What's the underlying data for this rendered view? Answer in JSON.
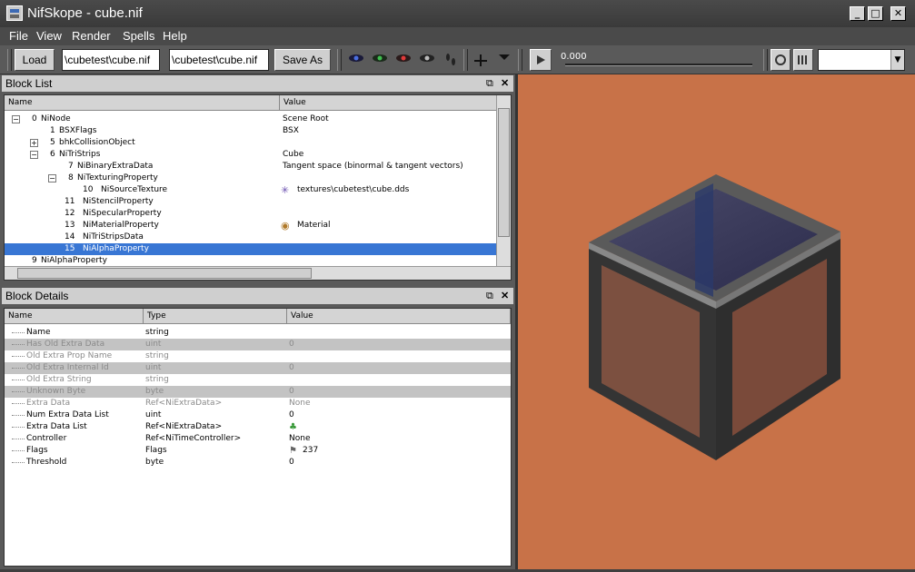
{
  "window": {
    "title": "NifSkope - cube.nif",
    "buttons": [
      "_",
      "□",
      "✕"
    ]
  },
  "menu": [
    "File",
    "View",
    "Render",
    "Spells",
    "Help"
  ],
  "toolbar": {
    "load_label": "Load",
    "path1": "\\cubetest\\cube.nif",
    "path2": "\\cubetest\\cube.nif",
    "save_label": "Save As",
    "time_value": "0.000",
    "combo_value": ""
  },
  "block_list": {
    "title": "Block List",
    "columns": [
      "Name",
      "Value"
    ],
    "rows": [
      {
        "num": "0",
        "name": "NiNode",
        "value": "Scene Root"
      },
      {
        "num": "1",
        "name": "BSXFlags",
        "value": "BSX"
      },
      {
        "num": "5",
        "name": "bhkCollisionObject",
        "value": ""
      },
      {
        "num": "6",
        "name": "NiTriStrips",
        "value": "Cube"
      },
      {
        "num": "7",
        "name": "NiBinaryExtraData",
        "value": "Tangent space (binormal & tangent vectors)"
      },
      {
        "num": "8",
        "name": "NiTexturingProperty",
        "value": ""
      },
      {
        "num": "10",
        "name": "NiSourceTexture",
        "value": "textures\\cubetest\\cube.dds"
      },
      {
        "num": "11",
        "name": "NiStencilProperty",
        "value": ""
      },
      {
        "num": "12",
        "name": "NiSpecularProperty",
        "value": ""
      },
      {
        "num": "13",
        "name": "NiMaterialProperty",
        "value": "Material"
      },
      {
        "num": "14",
        "name": "NiTriStripsData",
        "value": ""
      },
      {
        "num": "15",
        "name": "NiAlphaProperty",
        "value": ""
      },
      {
        "num": "9",
        "name": "NiAlphaProperty",
        "value": ""
      }
    ]
  },
  "block_details": {
    "title": "Block Details",
    "columns": [
      "Name",
      "Type",
      "Value"
    ],
    "rows": [
      {
        "name": "Name",
        "type": "string",
        "value": ""
      },
      {
        "name": "Has Old Extra Data",
        "type": "uint",
        "value": "0"
      },
      {
        "name": "Old Extra Prop Name",
        "type": "string",
        "value": ""
      },
      {
        "name": "Old Extra Internal Id",
        "type": "uint",
        "value": "0"
      },
      {
        "name": "Old Extra String",
        "type": "string",
        "value": ""
      },
      {
        "name": "Unknown Byte",
        "type": "byte",
        "value": "0"
      },
      {
        "name": "Extra Data",
        "type": "Ref<NiExtraData>",
        "value": "None"
      },
      {
        "name": "Num Extra Data List",
        "type": "uint",
        "value": "0"
      },
      {
        "name": "Extra Data List",
        "type": "Ref<NiExtraData>",
        "value": ""
      },
      {
        "name": "Controller",
        "type": "Ref<NiTimeController>",
        "value": "None"
      },
      {
        "name": "Flags",
        "type": "Flags",
        "value": "237"
      },
      {
        "name": "Threshold",
        "type": "byte",
        "value": "0"
      }
    ]
  },
  "colors": {
    "viewport_bg": "#c87248",
    "selection": "#3876d4"
  }
}
